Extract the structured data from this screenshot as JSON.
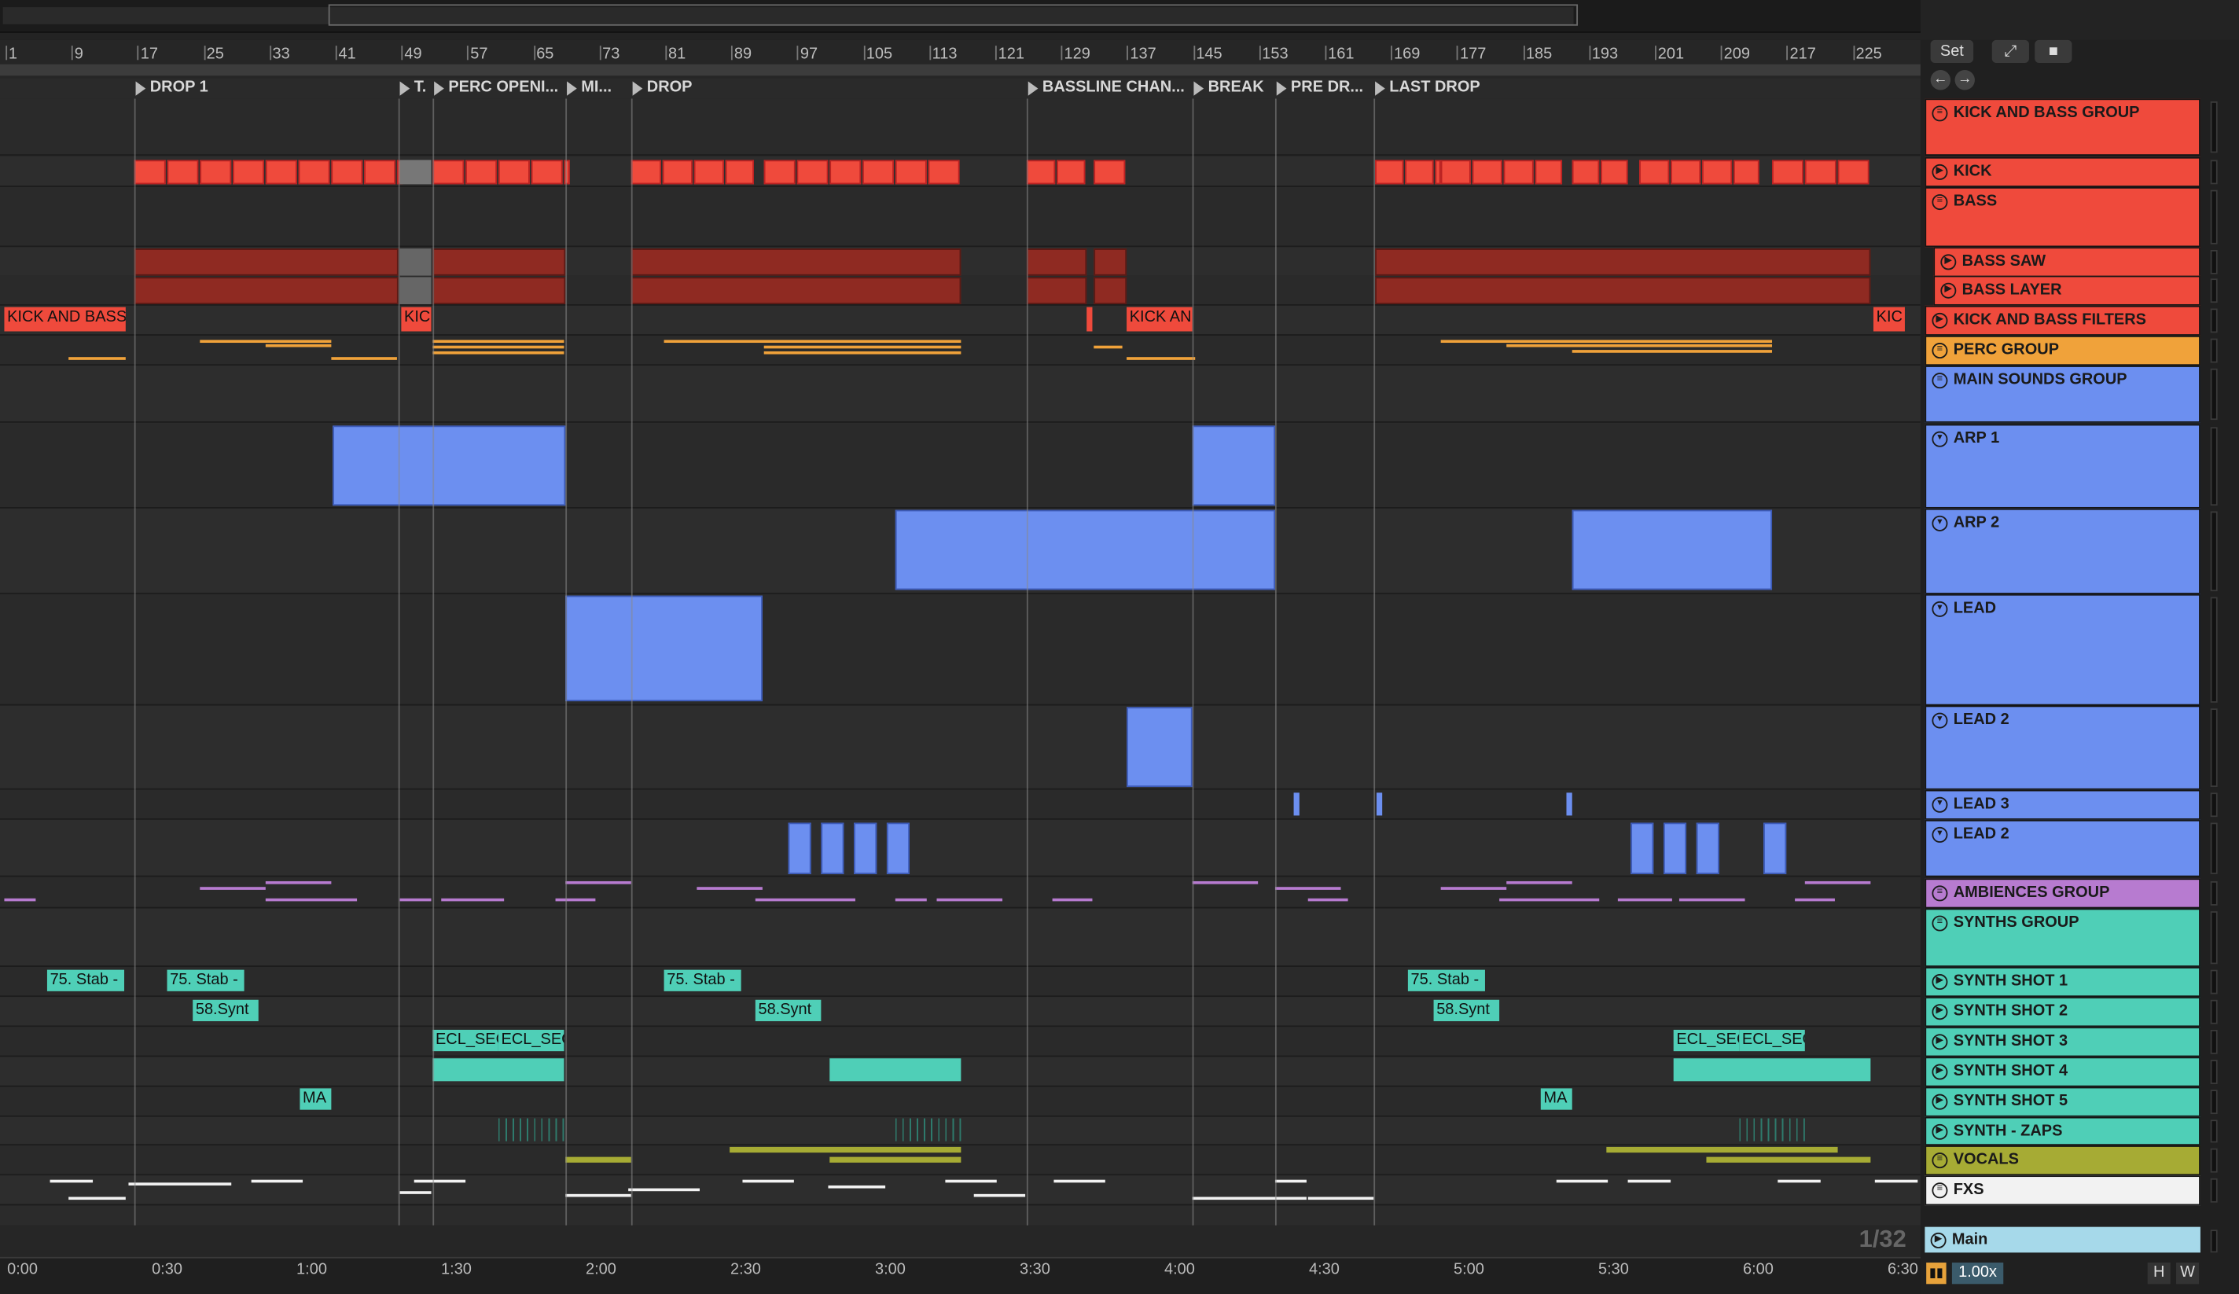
{
  "overview": {},
  "ruler": {
    "bars": [
      "1",
      "9",
      "17",
      "25",
      "33",
      "41",
      "49",
      "57",
      "65",
      "73",
      "81",
      "89",
      "97",
      "105",
      "113",
      "121",
      "129",
      "137",
      "145",
      "153",
      "161",
      "169",
      "177",
      "185",
      "193",
      "201",
      "209",
      "217",
      "225"
    ]
  },
  "locators": [
    "DROP 1",
    "T.",
    "PERC OPENI...",
    "MI...",
    "DROP",
    "BASSLINE CHAN...",
    "BREAK",
    "PRE DR...",
    "LAST DROP"
  ],
  "timeline": {
    "labels": [
      "0:00",
      "0:30",
      "1:00",
      "1:30",
      "2:00",
      "2:30",
      "3:00",
      "3:30",
      "4:00",
      "4:30",
      "5:00",
      "5:30",
      "6:00",
      "6:30"
    ]
  },
  "zoom_ratio": "1/32",
  "controls": {
    "set_label": "Set",
    "expand_icon": "expand-icon",
    "lock_icon": "lock-icon",
    "back_icon": "arrow-left-icon",
    "forward_icon": "arrow-right-icon",
    "zoom_value": "1.00x",
    "h_label": "H",
    "w_label": "W"
  },
  "clip_labels": {
    "kick_and_bass": "KICK AND BASS",
    "kic": "KIC",
    "kick_an": "KICK AN",
    "stab": "75. Stab -",
    "synth": "58.Synt",
    "ecl": "ECL_SEC",
    "ma": "MA"
  },
  "colors": {
    "red": "#ef4a3c",
    "dark_red": "#8f2a22",
    "orange": "#f0a23a",
    "blue": "#6c8ff0",
    "purple": "#b77bd0",
    "teal": "#4fcfb7",
    "olive": "#a6ab34",
    "white": "#f2f2f2",
    "main": "#a6d9ea"
  },
  "tracks": [
    {
      "name": "KICK AND BASS GROUP",
      "color": "#ef4a3c",
      "type": "group"
    },
    {
      "name": "KICK",
      "color": "#ef4a3c",
      "type": "audio"
    },
    {
      "name": "BASS",
      "color": "#ef4a3c",
      "type": "group"
    },
    {
      "name": "BASS SAW",
      "color": "#ef4a3c",
      "type": "audio"
    },
    {
      "name": "BASS LAYER",
      "color": "#ef4a3c",
      "type": "audio"
    },
    {
      "name": "KICK AND BASS FILTERS",
      "color": "#ef4a3c",
      "type": "audio"
    },
    {
      "name": "PERC GROUP",
      "color": "#f0a23a",
      "type": "group"
    },
    {
      "name": "MAIN SOUNDS GROUP",
      "color": "#6c8ff0",
      "type": "group"
    },
    {
      "name": "ARP 1",
      "color": "#6c8ff0",
      "type": "midi"
    },
    {
      "name": "ARP 2",
      "color": "#6c8ff0",
      "type": "midi"
    },
    {
      "name": "LEAD",
      "color": "#6c8ff0",
      "type": "midi"
    },
    {
      "name": "LEAD 2",
      "color": "#6c8ff0",
      "type": "midi"
    },
    {
      "name": "LEAD 3",
      "color": "#6c8ff0",
      "type": "midi"
    },
    {
      "name": "LEAD 2",
      "color": "#6c8ff0",
      "type": "midi"
    },
    {
      "name": "AMBIENCES GROUP",
      "color": "#b77bd0",
      "type": "group"
    },
    {
      "name": "SYNTHS GROUP",
      "color": "#4fcfb7",
      "type": "group"
    },
    {
      "name": "SYNTH SHOT 1",
      "color": "#4fcfb7",
      "type": "audio"
    },
    {
      "name": "SYNTH SHOT 2",
      "color": "#4fcfb7",
      "type": "audio"
    },
    {
      "name": "SYNTH SHOT 3",
      "color": "#4fcfb7",
      "type": "audio"
    },
    {
      "name": "SYNTH SHOT 4",
      "color": "#4fcfb7",
      "type": "audio"
    },
    {
      "name": "SYNTH SHOT 5",
      "color": "#4fcfb7",
      "type": "audio"
    },
    {
      "name": "SYNTH - ZAPS",
      "color": "#4fcfb7",
      "type": "audio"
    },
    {
      "name": "VOCALS",
      "color": "#a6ab34",
      "type": "group"
    },
    {
      "name": "FXS",
      "color": "#f2f2f2",
      "type": "group"
    }
  ],
  "main_track": {
    "name": "Main"
  }
}
